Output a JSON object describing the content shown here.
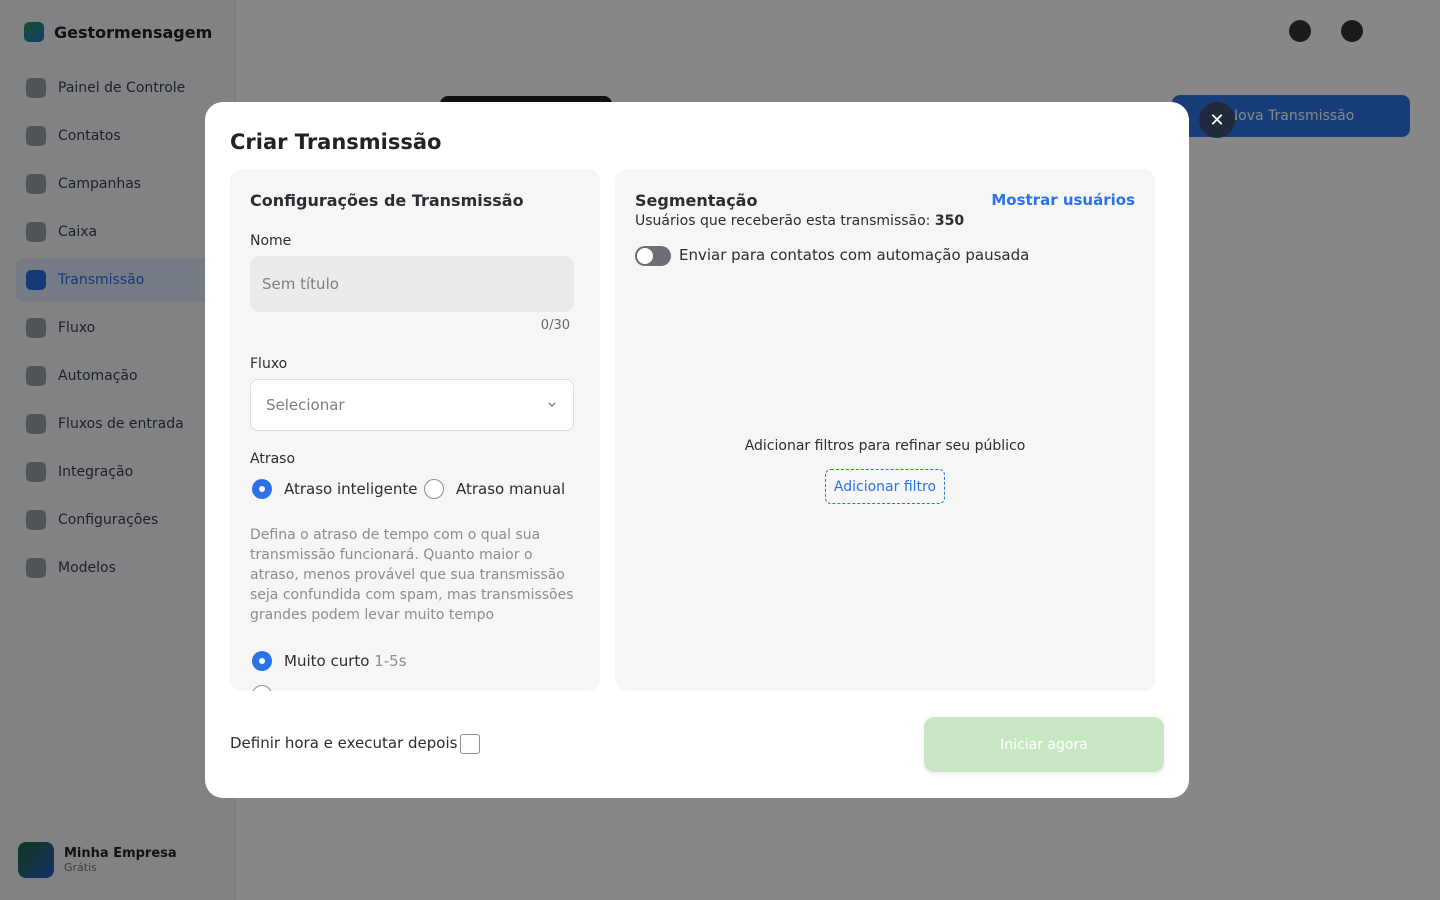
{
  "app": {
    "brand": "Gestormensagem",
    "nav_items": [
      {
        "label": "Painel de Controle",
        "icon": "dashboard-icon"
      },
      {
        "label": "Contatos",
        "icon": "contacts-icon"
      },
      {
        "label": "Campanhas",
        "icon": "campaigns-icon"
      },
      {
        "label": "Caixa",
        "icon": "inbox-icon"
      },
      {
        "label": "Transmissão",
        "icon": "broadcast-icon"
      },
      {
        "label": "Fluxo",
        "icon": "flow-icon"
      },
      {
        "label": "Automação",
        "icon": "automation-icon"
      },
      {
        "label": "Fluxos de entrada",
        "icon": "entry-flow-icon"
      },
      {
        "label": "Integração",
        "icon": "integration-icon"
      },
      {
        "label": "Configurações",
        "icon": "settings-icon"
      },
      {
        "label": "Modelos",
        "icon": "templates-icon"
      }
    ],
    "active_nav": "Transmissão",
    "profile": {
      "name": "Minha Empresa",
      "plan": "Grátis"
    },
    "new_broadcast_label": "Nova Transmissão"
  },
  "modal": {
    "title": "Criar Transmissão",
    "close_icon": "close-icon",
    "settings": {
      "title": "Configurações de Transmissão",
      "name_label": "Nome",
      "name_placeholder": "Sem título",
      "name_value": "",
      "name_counter": "0/30",
      "flow_label": "Fluxo",
      "flow_placeholder": "Selecionar",
      "delay_label": "Atraso",
      "delay_options": [
        {
          "label": "Atraso inteligente",
          "selected": true
        },
        {
          "label": "Atraso manual",
          "selected": false
        }
      ],
      "delay_description": "Defina o atraso de tempo com o qual sua transmissão funcionará. Quanto maior o atraso, menos provável que sua transmissão seja confundida com spam, mas transmissões grandes podem levar muito tempo",
      "speed_options": [
        {
          "label": "Muito curto",
          "range": "1-5s",
          "selected": true
        }
      ]
    },
    "segmentation": {
      "title": "Segmentação",
      "show_users": "Mostrar usuários",
      "users_text": "Usuários que receberão esta transmissão:",
      "users_count": "350",
      "paused_toggle_label": "Enviar para contatos com automação pausada",
      "paused_toggle_on": false,
      "empty_text": "Adicionar filtros para refinar seu público",
      "add_filter": "Adicionar filtro"
    },
    "footer": {
      "schedule_label": "Definir hora e executar depois",
      "schedule_checked": false,
      "start_button": "Iniciar agora"
    }
  }
}
